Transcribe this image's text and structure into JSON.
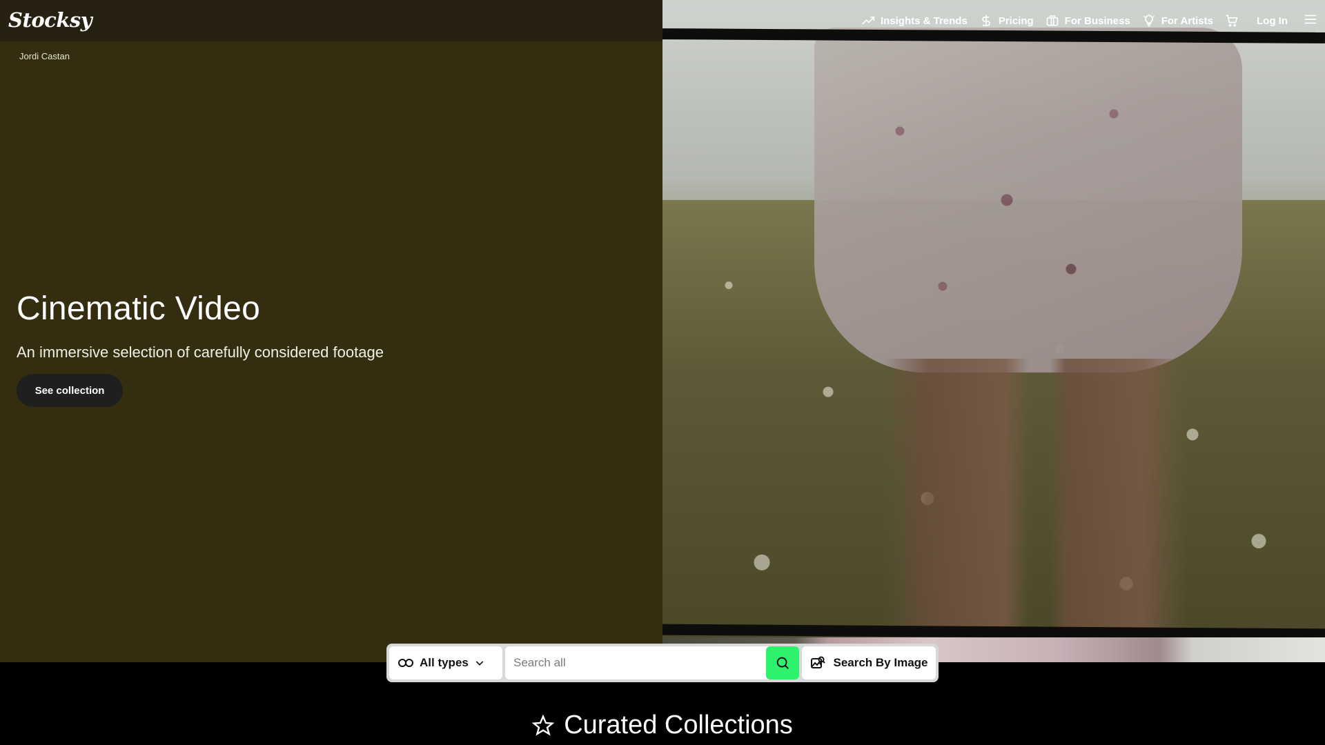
{
  "brand": {
    "logo_text": "Stocksy"
  },
  "nav": {
    "items": [
      {
        "label": "Insights & Trends",
        "icon": "trending-up-icon"
      },
      {
        "label": "Pricing",
        "icon": "dollar-icon"
      },
      {
        "label": "For Business",
        "icon": "briefcase-icon"
      },
      {
        "label": "For Artists",
        "icon": "lightbulb-icon"
      }
    ],
    "cart_icon": "cart-icon",
    "login_label": "Log In",
    "menu_icon": "hamburger-menu-icon"
  },
  "hero": {
    "credit": "Jordi Castan",
    "title": "Cinematic Video",
    "subtitle": "An immersive selection of carefully considered footage",
    "cta_label": "See collection",
    "bg_color": "#342d0f"
  },
  "search": {
    "type_label": "All types",
    "placeholder": "Search all",
    "image_search_label": "Search By Image",
    "accent_color": "#2ef26d"
  },
  "section": {
    "title": "Curated Collections",
    "icon": "star-icon"
  }
}
